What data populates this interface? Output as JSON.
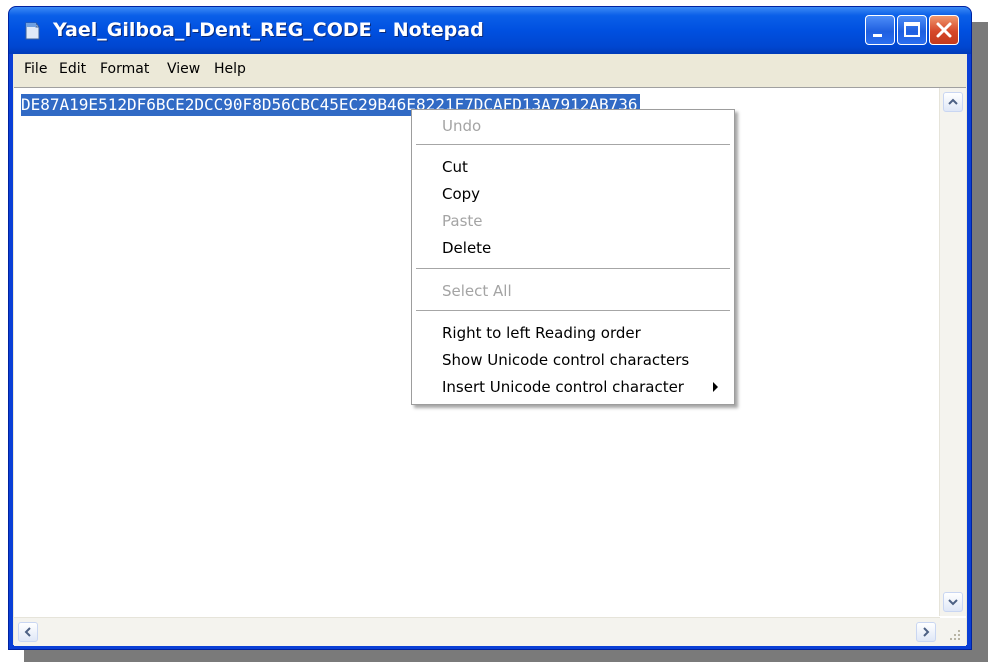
{
  "window": {
    "title": "Yael_Gilboa_I-Dent_REG_CODE - Notepad",
    "buttons": [
      "minimize",
      "maximize",
      "close"
    ],
    "accent_color": "#0a3fd6"
  },
  "menubar": {
    "items": [
      "File",
      "Edit",
      "Format",
      "View",
      "Help"
    ]
  },
  "editor": {
    "content": "DE87A19E512DF6BCE2DCC90F8D56CBC45EC29B46E8221F7DCAFD13A7912AB736",
    "selection_color": "#316ac5"
  },
  "context_menu": {
    "items": [
      {
        "label": "Undo",
        "enabled": false
      },
      {
        "label": "Cut",
        "enabled": true
      },
      {
        "label": "Copy",
        "enabled": true
      },
      {
        "label": "Paste",
        "enabled": false
      },
      {
        "label": "Delete",
        "enabled": true
      },
      {
        "label": "Select All",
        "enabled": false
      },
      {
        "label": "Right to left Reading order",
        "enabled": true
      },
      {
        "label": "Show Unicode control characters",
        "enabled": true
      },
      {
        "label": "Insert Unicode control character",
        "enabled": true,
        "submenu": true
      }
    ]
  }
}
